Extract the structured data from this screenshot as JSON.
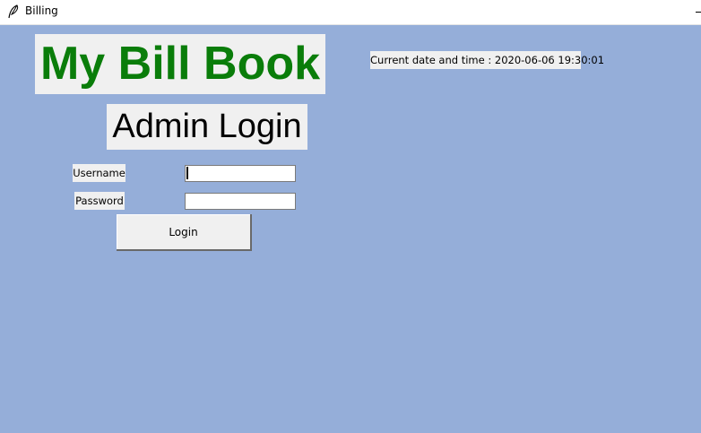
{
  "window": {
    "title": "Billing",
    "icon": "feather-icon"
  },
  "app": {
    "title": "My Bill Book",
    "title_color": "#0a7d0a",
    "background_color": "#95aed9"
  },
  "login": {
    "title": "Admin Login",
    "username_label": "Username",
    "username_value": "",
    "password_label": "Password",
    "password_value": "",
    "button_label": "Login"
  },
  "status": {
    "datetime_text": "Current date and time : 2020-06-06 19:30:01"
  }
}
